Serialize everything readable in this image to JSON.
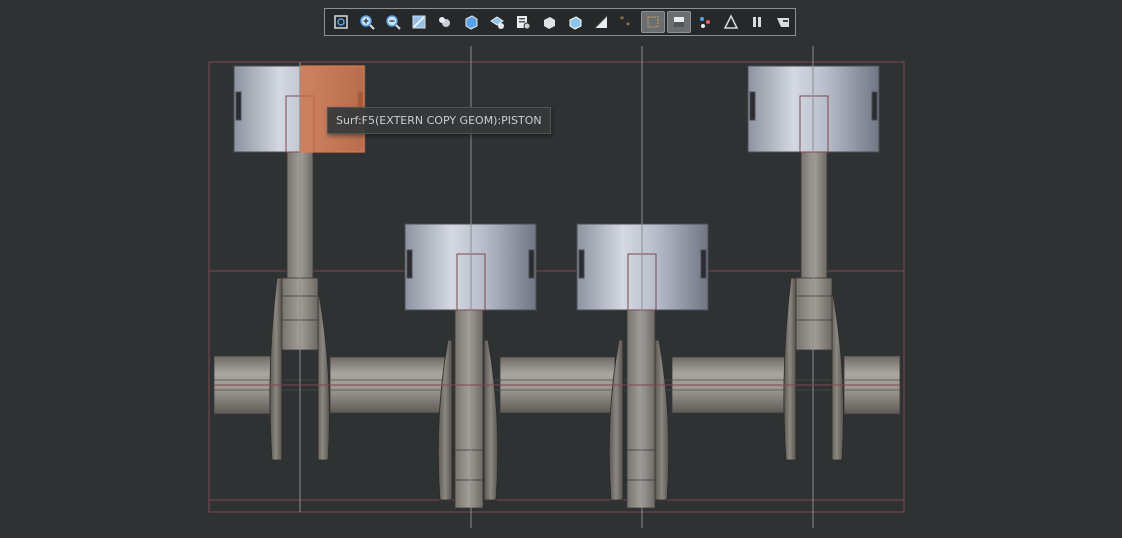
{
  "toolbar": {
    "buttons": [
      {
        "name": "refit-icon",
        "active": false
      },
      {
        "name": "zoom-in-icon",
        "active": false
      },
      {
        "name": "zoom-out-icon",
        "active": false
      },
      {
        "name": "repaint-icon",
        "active": false
      },
      {
        "name": "perspective-icon",
        "active": false
      },
      {
        "name": "saved-orientation-icon",
        "active": false
      },
      {
        "name": "view-manager-icon",
        "active": false
      },
      {
        "name": "appearance-gallery-icon",
        "active": false
      },
      {
        "name": "shading-icon",
        "active": false
      },
      {
        "name": "shading-edges-icon",
        "active": false
      },
      {
        "name": "section-icon",
        "active": false
      },
      {
        "name": "datum-display-icon",
        "active": false
      },
      {
        "name": "planes-display-icon",
        "active": true
      },
      {
        "name": "axes-display-icon",
        "active": true
      },
      {
        "name": "points-display-icon",
        "active": false
      },
      {
        "name": "csys-display-icon",
        "active": false
      },
      {
        "name": "pause-icon",
        "active": false
      },
      {
        "name": "annotation-display-icon",
        "active": false
      }
    ]
  },
  "tooltip": {
    "text": "Surf:F5(EXTERN COPY GEOM):PISTON"
  },
  "colors": {
    "background": "#2f3233",
    "highlight": "#d06a3a",
    "datum_lines": "#7d4850",
    "axis_lines": "#8a8e90"
  }
}
